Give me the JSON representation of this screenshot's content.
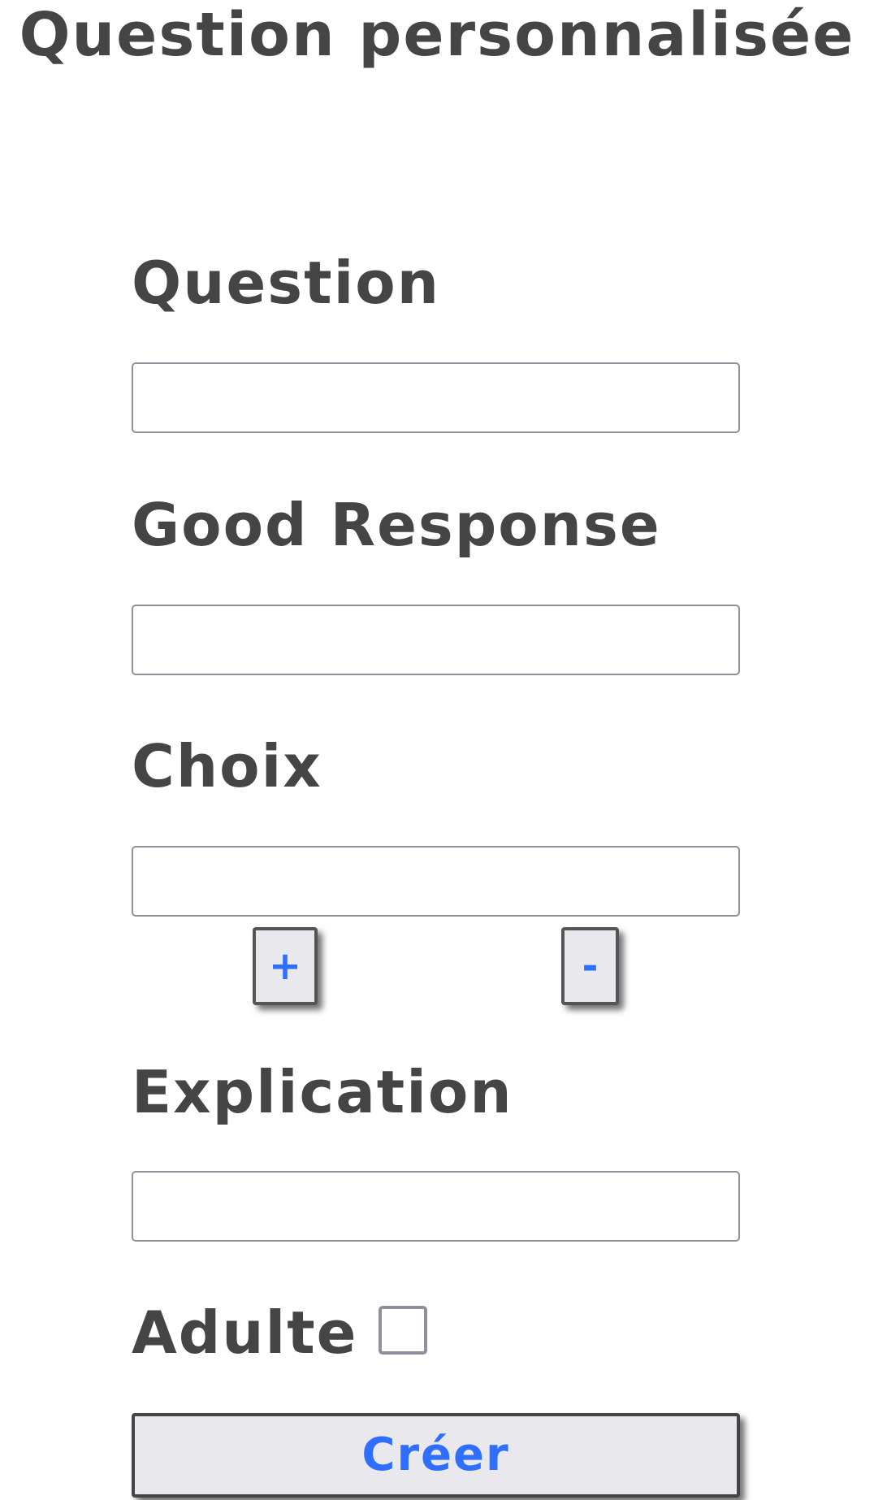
{
  "page": {
    "title": "Question personnalisée"
  },
  "form": {
    "question": {
      "label": "Question",
      "value": "",
      "placeholder": ""
    },
    "good_response": {
      "label": "Good Response",
      "value": "",
      "placeholder": ""
    },
    "choix": {
      "label": "Choix",
      "value": "",
      "placeholder": "",
      "add_label": "+",
      "remove_label": "-"
    },
    "explication": {
      "label": "Explication",
      "value": "",
      "placeholder": ""
    },
    "adulte": {
      "label": "Adulte",
      "checked": false
    },
    "submit_label": "Créer"
  },
  "colors": {
    "text": "#454545",
    "accent": "#2f6fff",
    "button_bg": "#e9e9ed",
    "input_border": "#8f8f9d"
  }
}
